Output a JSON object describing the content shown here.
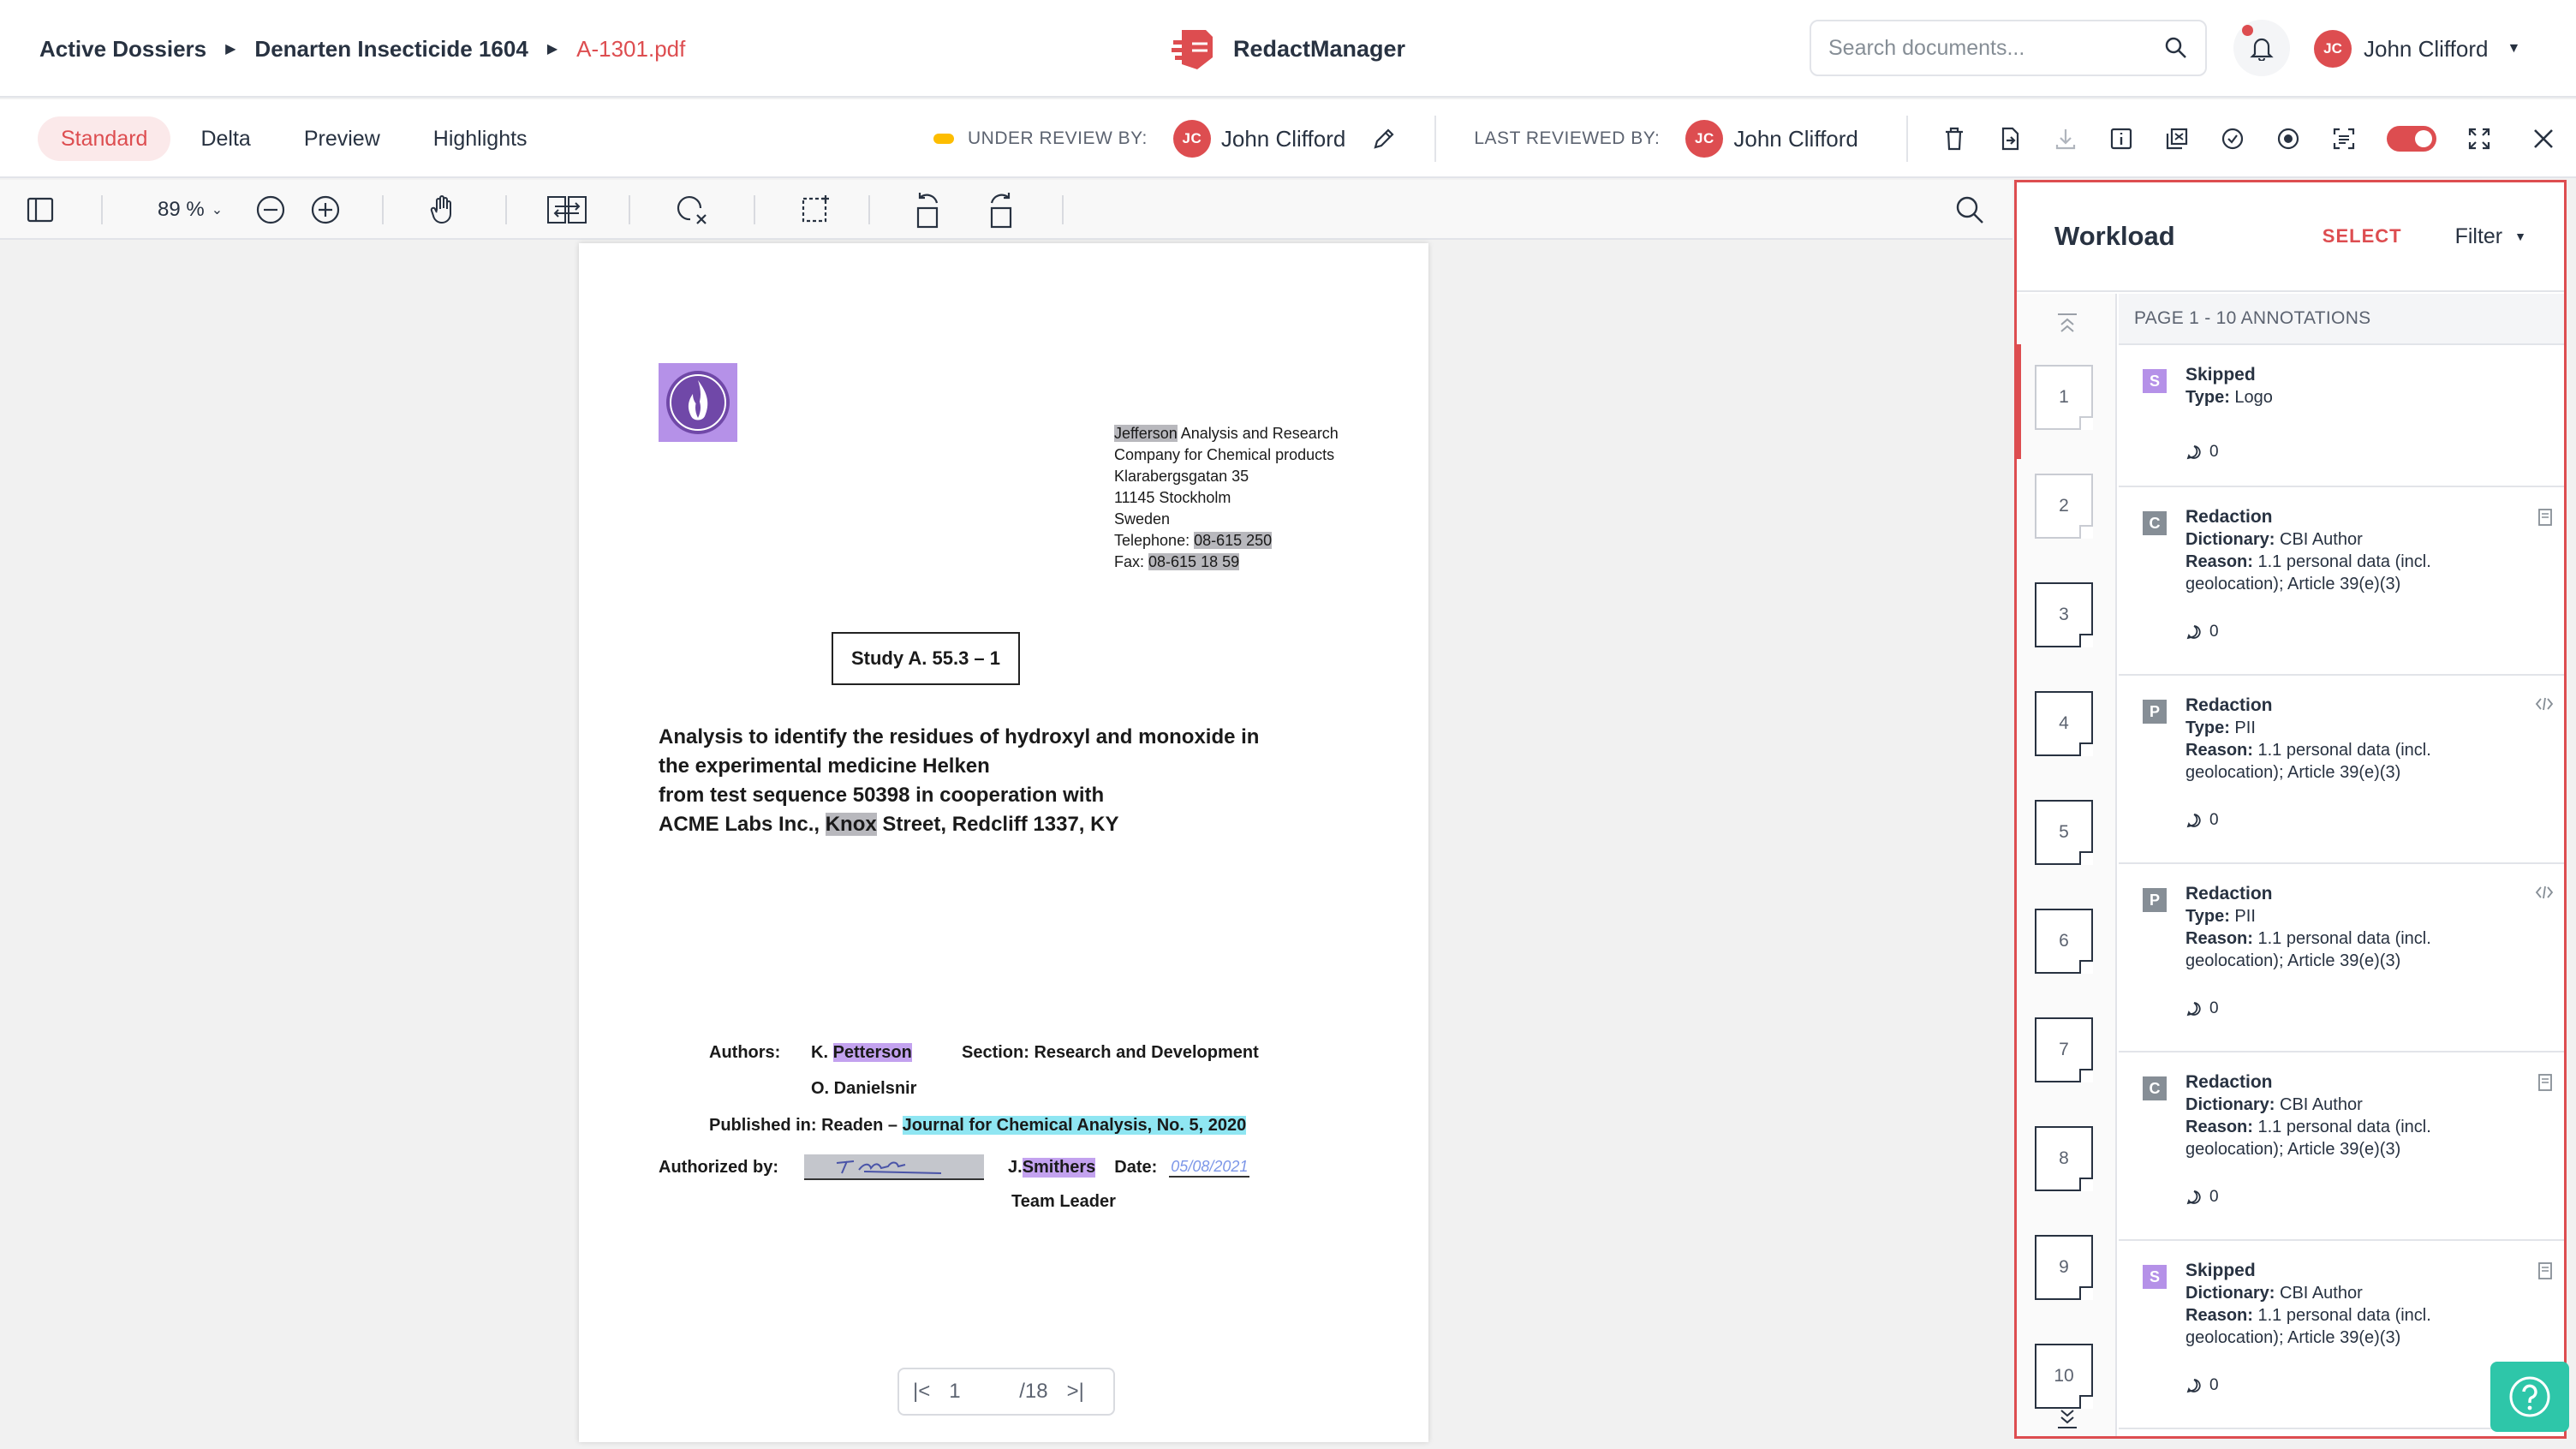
{
  "breadcrumb": {
    "items": [
      "Active Dossiers",
      "Denarten Insecticide 1604"
    ],
    "current": "A-1301.pdf"
  },
  "brand": {
    "name": "RedactManager"
  },
  "search": {
    "placeholder": "Search documents..."
  },
  "user": {
    "initials": "JC",
    "name": "John Clifford"
  },
  "tabs": [
    "Standard",
    "Delta",
    "Preview",
    "Highlights"
  ],
  "review": {
    "under_label": "UNDER REVIEW BY:",
    "under_initials": "JC",
    "under_name": "John Clifford",
    "last_label": "LAST REVIEWED BY:",
    "last_initials": "JC",
    "last_name": "John Clifford"
  },
  "viewer": {
    "zoom": "89 %"
  },
  "document": {
    "address": {
      "company_redacted": "Jefferson",
      "company_rest": " Analysis and Research Company for Chemical products",
      "street": "Klarabergsgatan 35",
      "city": "11145 Stockholm",
      "country": "Sweden",
      "tel_label": "Telephone: ",
      "tel_value": "08-615 250",
      "fax_label": "Fax: ",
      "fax_value": "08-615 18 59"
    },
    "study": "Study A. 55.3 – 1",
    "title_l1": "Analysis to identify the residues of hydroxyl and monoxide in",
    "title_l2": "the experimental medicine Helken",
    "title_l3": "from test sequence 50398 in cooperation with",
    "title_l4a": "ACME Labs Inc., ",
    "title_l4b": "Knox",
    "title_l4c": " Street, Redcliff 1337, KY",
    "authors_label": "Authors:",
    "author1_prefix": "K. ",
    "author1_name": "Petterson",
    "section": "Section: Research and Development",
    "author2": "O. Danielsnir",
    "published_label": "Published in: Readen – ",
    "published_journal": "Journal for Chemical Analysis, No. 5, 2020",
    "authorized_label": "Authorized by:",
    "signer_prefix": "J. ",
    "signer_name": "Smithers",
    "date_label": "Date:",
    "date_value": "05/08/2021",
    "team_leader": "Team Leader"
  },
  "pager": {
    "current": "1",
    "total": "/18"
  },
  "workload": {
    "title": "Workload",
    "select": "SELECT",
    "filter": "Filter",
    "page_header": "PAGE 1 - 10 ANNOTATIONS",
    "pages": [
      "1",
      "2",
      "3",
      "4",
      "5",
      "6",
      "7",
      "8",
      "9",
      "10"
    ],
    "annotations": [
      {
        "badge": "S",
        "badge_color": "#b591e8",
        "kind": "Skipped",
        "l1_label": "Type:",
        "l1_value": " Logo",
        "l2_label": "",
        "l2_value": "",
        "l3": "",
        "comments": "0"
      },
      {
        "badge": "C",
        "badge_color": "#868e96",
        "kind": "Redaction",
        "l1_label": "Dictionary:",
        "l1_value": " CBI Author",
        "l2_label": "Reason:",
        "l2_value": " 1.1 personal data (incl.",
        "l3": "geolocation); Article 39(e)(3)",
        "comments": "0"
      },
      {
        "badge": "P",
        "badge_color": "#868e96",
        "kind": "Redaction",
        "l1_label": "Type:",
        "l1_value": " PII",
        "l2_label": "Reason:",
        "l2_value": " 1.1 personal data (incl.",
        "l3": "geolocation); Article 39(e)(3)",
        "comments": "0"
      },
      {
        "badge": "P",
        "badge_color": "#868e96",
        "kind": "Redaction",
        "l1_label": "Type:",
        "l1_value": " PII",
        "l2_label": "Reason:",
        "l2_value": " 1.1 personal data (incl.",
        "l3": "geolocation); Article 39(e)(3)",
        "comments": "0"
      },
      {
        "badge": "C",
        "badge_color": "#868e96",
        "kind": "Redaction",
        "l1_label": "Dictionary:",
        "l1_value": " CBI Author",
        "l2_label": "Reason:",
        "l2_value": " 1.1 personal data (incl.",
        "l3": "geolocation); Article 39(e)(3)",
        "comments": "0"
      },
      {
        "badge": "S",
        "badge_color": "#b591e8",
        "kind": "Skipped",
        "l1_label": "Dictionary:",
        "l1_value": " CBI Author",
        "l2_label": "Reason:",
        "l2_value": " 1.1 personal data (incl.",
        "l3": "geolocation); Article 39(e)(3)",
        "comments": "0"
      }
    ]
  },
  "colors": {
    "accent": "#dd4d50",
    "redaction_grey": "#b8b8bd",
    "skipped_purple": "#b591e8",
    "journal_cyan": "#8fe6f2",
    "help": "#2ec6a9"
  }
}
